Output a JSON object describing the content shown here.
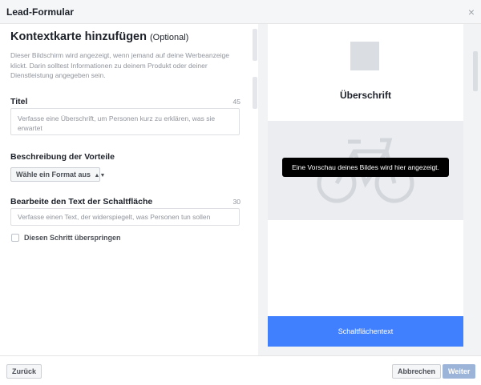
{
  "window": {
    "title": "Lead-Formular",
    "close_glyph": "×"
  },
  "form": {
    "heading": "Kontextkarte hinzufügen",
    "heading_optional": "(Optional)",
    "description": "Dieser Bildschirm wird angezeigt, wenn jemand auf deine Werbeanzeige klickt. Darin solltest Informationen zu deinem Produkt oder deiner Dienstleistung angegeben sein.",
    "title_field": {
      "label": "Titel",
      "count": "45",
      "placeholder": "Verfasse eine Überschrift, um Personen kurz zu erklären, was sie erwartet"
    },
    "benefits": {
      "label": "Beschreibung der Vorteile",
      "format_select": "Wähle ein Format aus",
      "caret": "▲▼"
    },
    "button_text_field": {
      "label": "Bearbeite den Text der Schaltfläche",
      "count": "30",
      "placeholder": "Verfasse einen Text, der widerspiegelt, was Personen tun sollen"
    },
    "skip_step": {
      "label": "Diesen Schritt überspringen",
      "checked": false
    }
  },
  "preview": {
    "heading": "Überschrift",
    "image_tooltip": "Eine Vorschau deines Bildes wird hier angezeigt.",
    "cta_label": "Schaltflächentext",
    "image_placeholder_icon": "bicycle-icon",
    "logo_placeholder_color": "#dadde1",
    "cta_color": "#4080ff"
  },
  "footer": {
    "back_label": "Zurück",
    "cancel_label": "Abbrechen",
    "next_label": "Weiter"
  }
}
